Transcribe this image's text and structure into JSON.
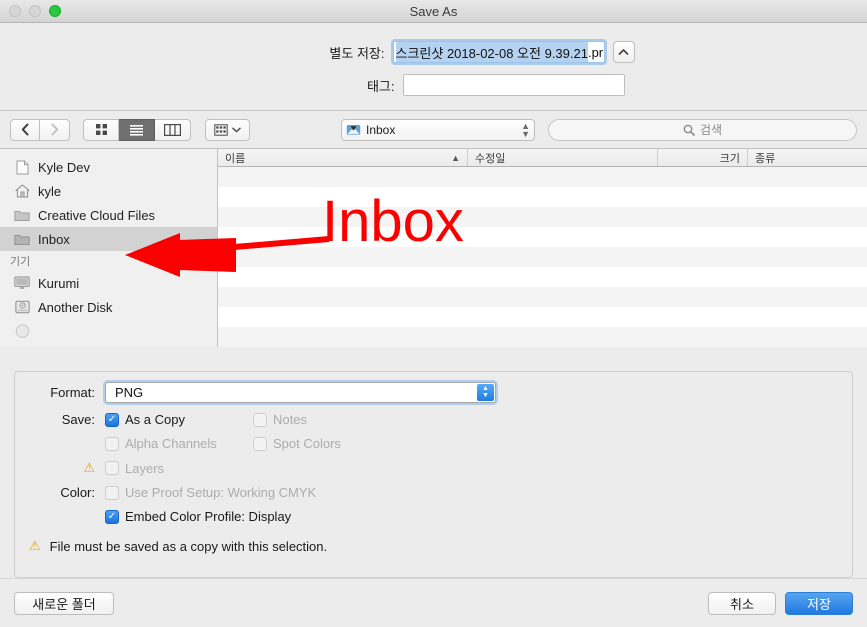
{
  "window": {
    "title": "Save As",
    "traffic_lights": [
      "close",
      "minimize",
      "zoom"
    ]
  },
  "name_area": {
    "save_as_label": "별도 저장:",
    "filename_selected": "스크린샷 2018-02-08 오전 9.39.21",
    "filename_tail": ".pr",
    "disclose_icon": "chevron-up-icon",
    "tags_label": "태그:",
    "tags_value": "",
    "tags_placeholder": ""
  },
  "toolbar": {
    "back_icon": "chevron-left-icon",
    "forward_icon": "chevron-right-icon",
    "view_icon_grid": "icon-view-icon",
    "view_list": "list-view-icon",
    "view_columns": "column-view-icon",
    "arrange_icon": "arrange-grid-icon",
    "arrange_caret": "chevron-down-icon",
    "path_icon": "inbox-tray-icon",
    "path_label": "Inbox",
    "path_steps_icon": "updown-stepper-icon",
    "search_icon": "search-icon",
    "search_placeholder": "검색",
    "search_value": ""
  },
  "sidebar": {
    "favorites": [
      {
        "label": "Kyle Dev",
        "icon": "document-icon",
        "selected": false
      },
      {
        "label": "kyle",
        "icon": "home-icon",
        "selected": false
      },
      {
        "label": "Creative Cloud Files",
        "icon": "folder-icon",
        "selected": false
      },
      {
        "label": "Inbox",
        "icon": "folder-icon",
        "selected": true
      }
    ],
    "devices_header": "기기",
    "devices": [
      {
        "label": "Kurumi",
        "icon": "display-icon",
        "selected": false
      },
      {
        "label": "Another Disk",
        "icon": "harddisk-icon",
        "selected": false
      }
    ]
  },
  "filelist": {
    "columns": [
      {
        "label": "이름",
        "sort": "ascending",
        "sort_icon": "chevron-up-icon"
      },
      {
        "label": "수정일",
        "sort": "none"
      },
      {
        "label": "크기",
        "sort": "none"
      },
      {
        "label": "종류",
        "sort": "none"
      }
    ],
    "rows": [],
    "empty": true
  },
  "options": {
    "format_label": "Format:",
    "format_value": "PNG",
    "format_stepper_icon": "updown-stepper-icon",
    "save_label": "Save:",
    "color_label": "Color:",
    "checkboxes": {
      "as_a_copy": {
        "label": "As a Copy",
        "checked": true,
        "enabled": true
      },
      "notes": {
        "label": "Notes",
        "checked": false,
        "enabled": false
      },
      "alpha_channels": {
        "label": "Alpha Channels",
        "checked": false,
        "enabled": false
      },
      "spot_colors": {
        "label": "Spot Colors",
        "checked": false,
        "enabled": false
      },
      "layers": {
        "label": "Layers",
        "checked": false,
        "enabled": false,
        "warning_icon": "warning-triangle-icon"
      },
      "use_proof_setup": {
        "label": "Use Proof Setup:  Working CMYK",
        "checked": false,
        "enabled": false
      },
      "embed_color_profile": {
        "label": "Embed Color Profile:  Display",
        "checked": true,
        "enabled": true
      }
    },
    "warning_icon": "warning-triangle-icon",
    "warning_text": "File must be saved as a copy with this selection."
  },
  "footer": {
    "new_folder_label": "새로운 폴더",
    "cancel_label": "취소",
    "save_label": "저장"
  },
  "annotation": {
    "text": "Inbox",
    "color": "#fb0000",
    "arrow_icon": "left-arrow-annotation-icon"
  }
}
